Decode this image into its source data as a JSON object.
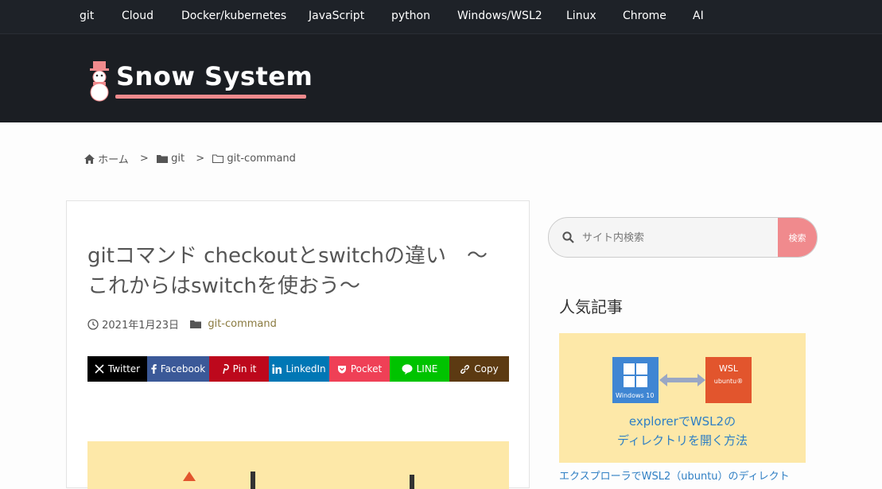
{
  "nav": [
    "git",
    "Cloud",
    "Docker/kubernetes",
    "JavaScript",
    "python",
    "Windows/WSL2",
    "Linux",
    "Chrome",
    "AI"
  ],
  "site": {
    "name": "Snow System"
  },
  "breadcrumb": {
    "home": "ホーム",
    "sep": ">",
    "cat": "git",
    "sub": "git-command"
  },
  "article": {
    "title_line1": "gitコマンド checkoutとswitchの違い　〜",
    "title_line2": "これからはswitchを使おう〜",
    "date": "2021年1月23日",
    "category": "git-command"
  },
  "share": [
    {
      "label": "Twitter",
      "color": "#000000",
      "icon": "x-icon"
    },
    {
      "label": "Facebook",
      "color": "#3b5998",
      "icon": "facebook-icon"
    },
    {
      "label": "Pin it",
      "color": "#bd081c",
      "icon": "pinterest-icon"
    },
    {
      "label": "LinkedIn",
      "color": "#0077b5",
      "icon": "linkedin-icon"
    },
    {
      "label": "Pocket",
      "color": "#ef4056",
      "icon": "pocket-icon"
    },
    {
      "label": "LINE",
      "color": "#00c300",
      "icon": "line-icon"
    },
    {
      "label": "Copy",
      "color": "#5c3a12",
      "icon": "link-icon"
    }
  ],
  "search": {
    "placeholder": "サイト内検索",
    "button": "検索"
  },
  "sidebar": {
    "popular_title": "人気記事",
    "thumb": {
      "windows_label": "Windows 10",
      "wsl_label": "WSL",
      "ubuntu_label": "ubuntu®",
      "line1": "explorerでWSL2の",
      "line2": "ディレクトリを開く方法"
    },
    "post_title": "エクスプローラでWSL2（ubuntu）のディレクト"
  },
  "colors": {
    "accent": "#f08a8d",
    "header_bg": "#1b1e23",
    "link": "#2f7fc4"
  }
}
